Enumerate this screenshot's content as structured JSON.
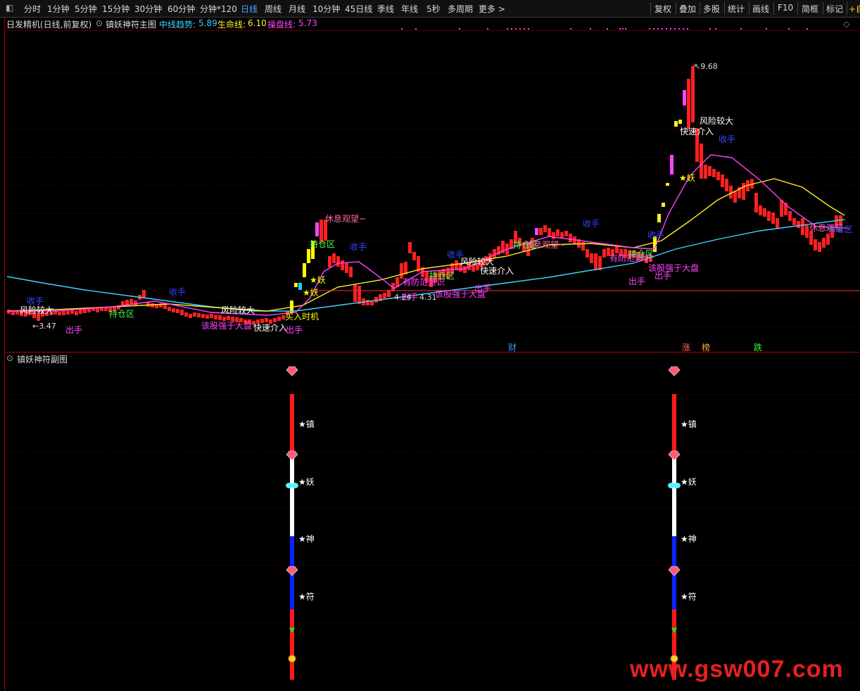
{
  "toolbar": {
    "left_items": [
      "分时",
      "1分钟",
      "5分钟",
      "15分钟",
      "30分钟",
      "60分钟",
      "分钟*120",
      "日线",
      "周线",
      "月线",
      "10分钟",
      "45日线",
      "季线",
      "年线",
      "5秒",
      "多周期",
      "更多 >"
    ],
    "active": "日线",
    "right_items": [
      "复权",
      "叠加",
      "多股",
      "统计",
      "画线",
      "F10",
      "简框",
      "标记"
    ],
    "corner": "+自"
  },
  "main_panel": {
    "stock_title": "日发精机(日线,前复权)",
    "indicator_name": "镇妖神符主图",
    "params": [
      {
        "label": "中线趋势:",
        "value": "5.89",
        "color": "#3fd0ff"
      },
      {
        "label": "生命线:",
        "value": "6.10",
        "color": "#ffee22"
      },
      {
        "label": "操盘线:",
        "value": "5.73",
        "color": "#ff44ff"
      }
    ],
    "price_labels": {
      "high": "9.68",
      "low": "3.47",
      "mid1": "4.24",
      "mid2": "4.31"
    },
    "annotations": [
      {
        "text": "风险较大",
        "color": "#ffffff"
      },
      {
        "text": "收手",
        "color": "#3344ff"
      },
      {
        "text": "出手",
        "color": "#ff44ff"
      },
      {
        "text": "持仓区",
        "color": "#44ff44"
      },
      {
        "text": "快速介入",
        "color": "#ffffff"
      },
      {
        "text": "该股强于大盘",
        "color": "#ff44ff"
      },
      {
        "text": "休息观望~",
        "color": "#ff66aa"
      },
      {
        "text": "买入时机",
        "color": "#ffff00"
      },
      {
        "text": "★妖",
        "color": "#ffff00"
      },
      {
        "text": "有防范意识",
        "color": "#ff44ff"
      }
    ],
    "bottom_tags": [
      {
        "text": "财",
        "color": "#3399ff"
      },
      {
        "text": "涨",
        "color": "#ff6666"
      },
      {
        "text": "榜",
        "color": "#ffaa33"
      },
      {
        "text": "跌",
        "color": "#33ff33"
      }
    ]
  },
  "sub_panel": {
    "indicator_name": "镇妖神符副图",
    "stars": [
      "★镇",
      "★妖",
      "★神",
      "★符"
    ]
  },
  "watermark": "www.gsw007.com",
  "colors": {
    "up": "#ff2020",
    "down": "#00e0e0",
    "trend": "#3fd0ff",
    "life": "#ffee22",
    "op": "#ff44ff"
  }
}
